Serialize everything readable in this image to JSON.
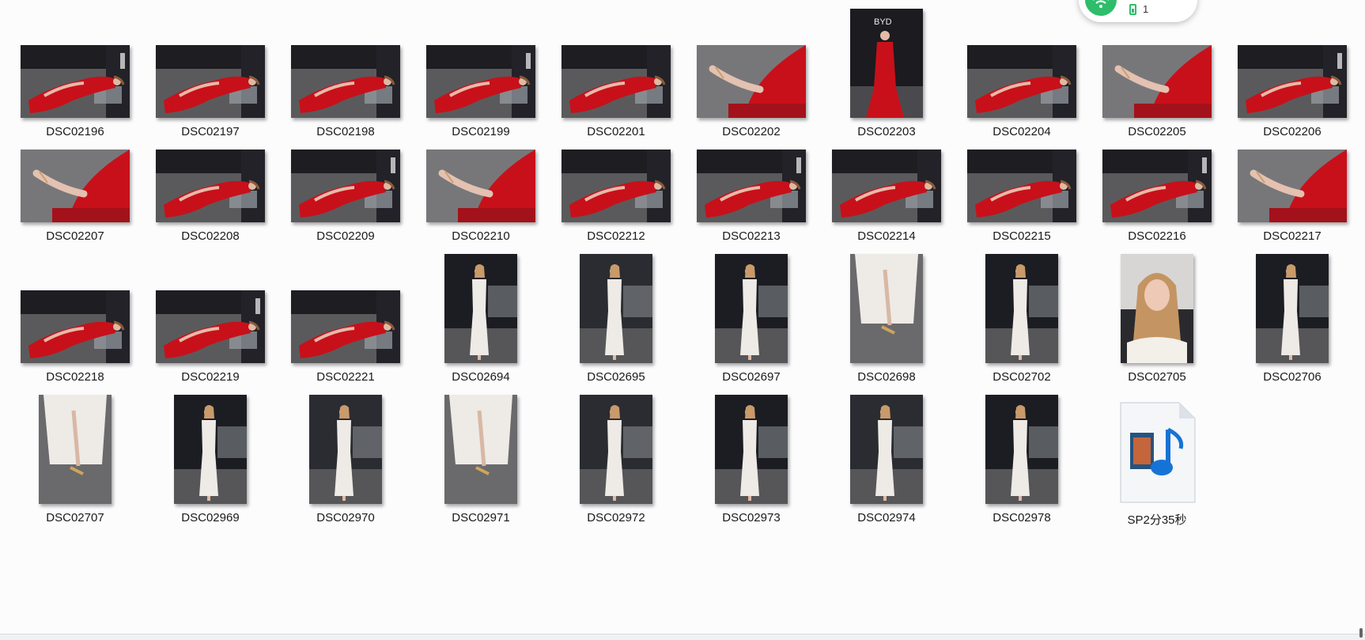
{
  "files": [
    {
      "name": "DSC02196",
      "kind": "red-landscape"
    },
    {
      "name": "DSC02197",
      "kind": "red-landscape"
    },
    {
      "name": "DSC02198",
      "kind": "red-landscape"
    },
    {
      "name": "DSC02199",
      "kind": "red-landscape"
    },
    {
      "name": "DSC02201",
      "kind": "red-landscape"
    },
    {
      "name": "DSC02202",
      "kind": "red-closeup"
    },
    {
      "name": "DSC02203",
      "kind": "red-portrait"
    },
    {
      "name": "DSC02204",
      "kind": "red-landscape"
    },
    {
      "name": "DSC02205",
      "kind": "red-closeup"
    },
    {
      "name": "DSC02206",
      "kind": "red-landscape"
    },
    {
      "name": "DSC02207",
      "kind": "red-closeup"
    },
    {
      "name": "DSC02208",
      "kind": "red-landscape"
    },
    {
      "name": "DSC02209",
      "kind": "red-landscape"
    },
    {
      "name": "DSC02210",
      "kind": "red-closeup"
    },
    {
      "name": "DSC02212",
      "kind": "red-landscape"
    },
    {
      "name": "DSC02213",
      "kind": "red-landscape"
    },
    {
      "name": "DSC02214",
      "kind": "red-landscape"
    },
    {
      "name": "DSC02215",
      "kind": "red-landscape"
    },
    {
      "name": "DSC02216",
      "kind": "red-landscape"
    },
    {
      "name": "DSC02217",
      "kind": "red-closeup"
    },
    {
      "name": "DSC02218",
      "kind": "red-landscape"
    },
    {
      "name": "DSC02219",
      "kind": "red-landscape"
    },
    {
      "name": "DSC02221",
      "kind": "red-landscape"
    },
    {
      "name": "DSC02694",
      "kind": "white-portrait"
    },
    {
      "name": "DSC02695",
      "kind": "white-portrait"
    },
    {
      "name": "DSC02697",
      "kind": "white-portrait"
    },
    {
      "name": "DSC02698",
      "kind": "white-closeup"
    },
    {
      "name": "DSC02702",
      "kind": "white-portrait"
    },
    {
      "name": "DSC02705",
      "kind": "white-face"
    },
    {
      "name": "DSC02706",
      "kind": "white-portrait"
    },
    {
      "name": "DSC02707",
      "kind": "white-closeup"
    },
    {
      "name": "DSC02969",
      "kind": "white-portrait"
    },
    {
      "name": "DSC02970",
      "kind": "white-portrait"
    },
    {
      "name": "DSC02971",
      "kind": "white-closeup"
    },
    {
      "name": "DSC02972",
      "kind": "white-portrait"
    },
    {
      "name": "DSC02973",
      "kind": "white-portrait"
    },
    {
      "name": "DSC02974",
      "kind": "white-portrait"
    },
    {
      "name": "DSC02978",
      "kind": "white-portrait"
    },
    {
      "name": "SP2分35秒",
      "kind": "media-file"
    }
  ],
  "status_widget": {
    "wifi_icon": "wifi-icon",
    "battery_icon": "battery-icon",
    "count": "1",
    "accent": "#2ebd6a"
  },
  "colors": {
    "background": "#fcfcfd",
    "dress_red": "#c8101a",
    "dress_white": "#eeeae6"
  }
}
